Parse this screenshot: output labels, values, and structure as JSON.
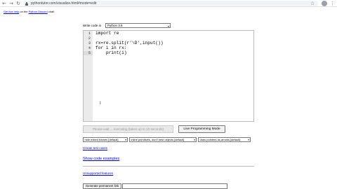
{
  "browser": {
    "back_icon": "←",
    "forward_icon": "→",
    "reload_icon": "↻",
    "url": "pythontutor.com/visualize.html#mode=edit",
    "star_icon": "☆",
    "menu_icon": "⋮"
  },
  "help": {
    "link_text": "Get live help",
    "middle_text": " on the ",
    "discord_text": "Python Discord",
    "end_text": " chat!"
  },
  "editor": {
    "label": "Write code in",
    "language": "Python 3.6",
    "line_numbers": [
      "1",
      "2",
      "3",
      "4",
      "5"
    ],
    "code_lines": [
      "import re",
      "",
      "rx=re.split(r'\\D',input())",
      "for i in rx:",
      "    print(i)"
    ],
    "active_line": 5,
    "text_cursor_icon": "I"
  },
  "buttons": {
    "visualize": "Please wait ... executing (takes up to 10 seconds)",
    "live": "Live Programming Mode",
    "permalink": "Generate permanent link"
  },
  "options": {
    "frames": "hide exited frames [default]",
    "primitives": "inline primitives, don't nest objects [default]",
    "pointers": "draw pointers as arrows [default]"
  },
  "links": {
    "create_test": "Create test cases",
    "show_examples": "Show code examples",
    "unsupported": "Unsupported features"
  },
  "permalink_value": ""
}
